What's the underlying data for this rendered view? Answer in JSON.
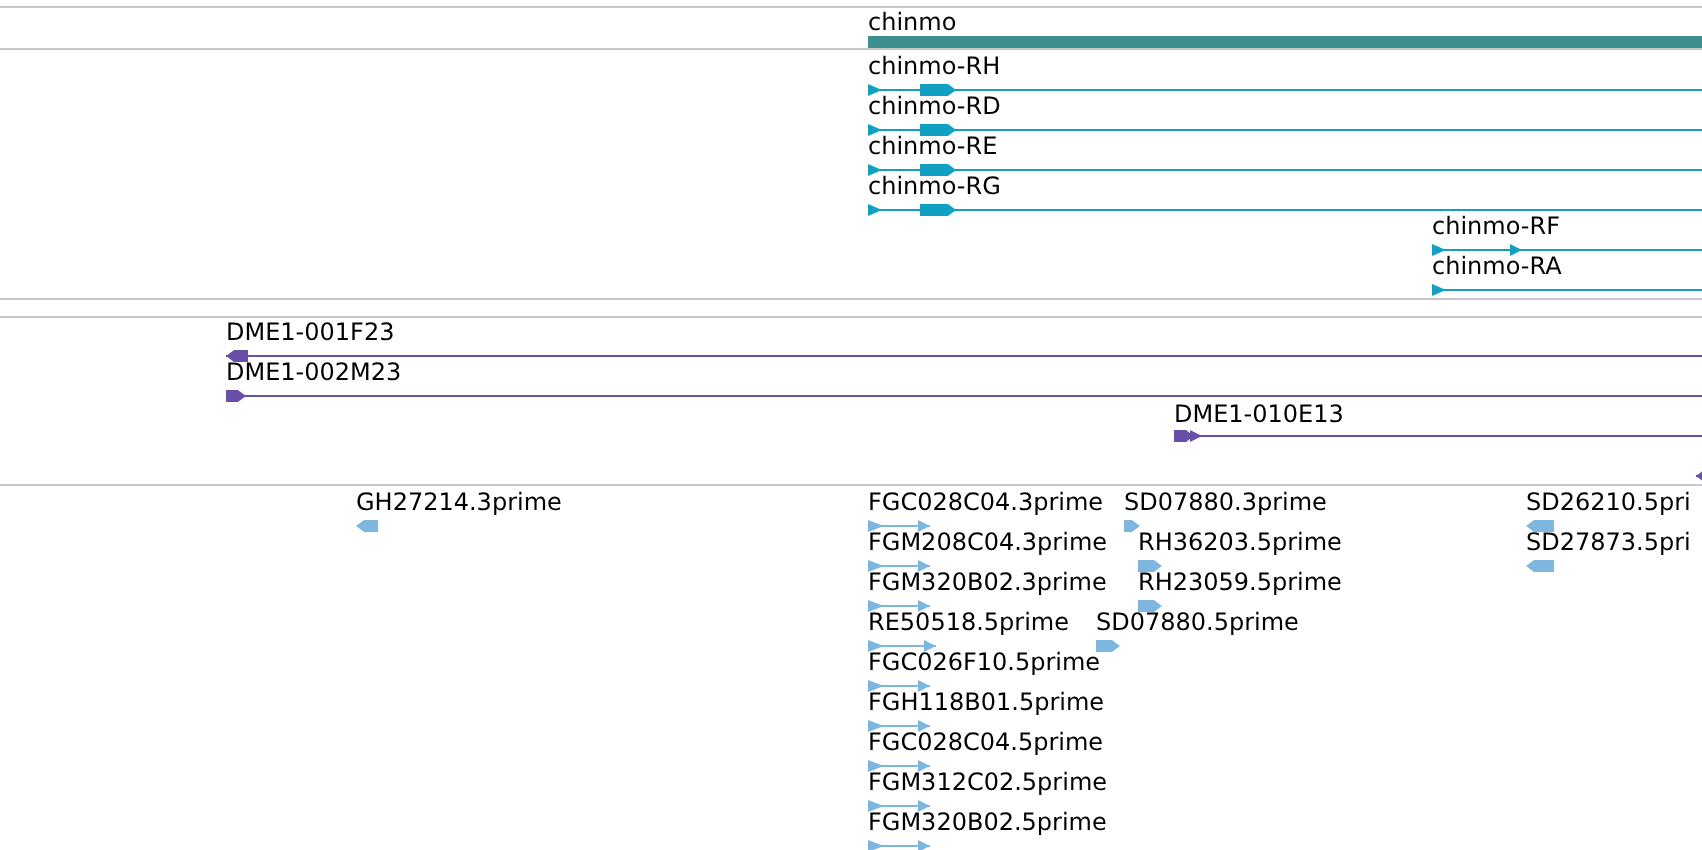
{
  "tracks": [
    {
      "kind": "gene",
      "features": [
        {
          "label": "chinmo"
        }
      ]
    },
    {
      "kind": "transcript",
      "features": [
        {
          "label": "chinmo-RH",
          "forward": true
        },
        {
          "label": "chinmo-RD",
          "forward": true
        },
        {
          "label": "chinmo-RE",
          "forward": true
        },
        {
          "label": "chinmo-RG",
          "forward": true
        },
        {
          "label": "chinmo-RF",
          "forward": true
        },
        {
          "label": "chinmo-RA",
          "forward": true
        }
      ]
    },
    {
      "kind": "clone",
      "features": [
        {
          "label": "DME1-001F23",
          "forward": false
        },
        {
          "label": "DME1-002M23",
          "forward": true
        },
        {
          "label": "DME1-010E13",
          "forward": true
        },
        {
          "forward": false
        }
      ]
    },
    {
      "kind": "est",
      "features": [
        {
          "label": "GH27214.3prime",
          "forward": false
        },
        {
          "label": "FGC028C04.3prime",
          "forward": true
        },
        {
          "label": "FGM208C04.3prime",
          "forward": true
        },
        {
          "label": "FGM320B02.3prime",
          "forward": true
        },
        {
          "label": "RE50518.5prime",
          "forward": true
        },
        {
          "label": "FGC026F10.5prime",
          "forward": true
        },
        {
          "label": "FGH118B01.5prime",
          "forward": true
        },
        {
          "label": "FGC028C04.5prime",
          "forward": true
        },
        {
          "label": "FGM312C02.5prime",
          "forward": true
        },
        {
          "label": "FGM320B02.5prime",
          "forward": true
        },
        {
          "label": "SD07880.3prime",
          "forward": true
        },
        {
          "label": "RH36203.5prime",
          "forward": true
        },
        {
          "label": "RH23059.5prime",
          "forward": true
        },
        {
          "label": "SD07880.5prime",
          "forward": true
        },
        {
          "label": "SD26210.5pri",
          "forward": false
        },
        {
          "label": "SD27873.5pri",
          "forward": false
        }
      ]
    }
  ]
}
